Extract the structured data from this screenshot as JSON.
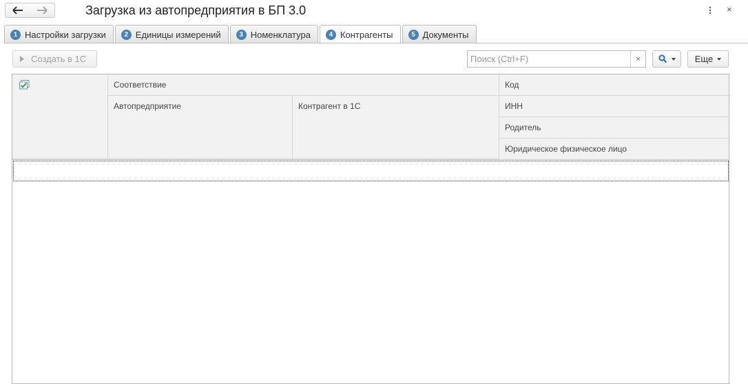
{
  "window": {
    "title": "Загрузка из автопредприятия в БП 3.0",
    "icons": {
      "back": "arrow-left-icon",
      "forward": "arrow-right-icon",
      "more": "vertical-dots-icon",
      "close": "close-icon"
    },
    "close_glyph": "×"
  },
  "tabs": [
    {
      "num": "1",
      "label": "Настройки загрузки",
      "active": false
    },
    {
      "num": "2",
      "label": "Единицы измерений",
      "active": false
    },
    {
      "num": "3",
      "label": "Номенклатура",
      "active": false
    },
    {
      "num": "4",
      "label": "Контрагенты",
      "active": true
    },
    {
      "num": "5",
      "label": "Документы",
      "active": false
    }
  ],
  "toolbar": {
    "create_label": "Создать в 1С",
    "create_enabled": false,
    "search_placeholder": "Поиск (Ctrl+F)",
    "search_value": "",
    "clear_glyph": "×",
    "more_label": "Еще"
  },
  "table": {
    "headers": {
      "match": "Соответствие",
      "autoenterprise": "Автопредприятие",
      "counterparty": "Контрагент в 1С",
      "code": "Код",
      "inn": "ИНН",
      "parent": "Родитель",
      "legal_type": "Юридическое физическое лицо"
    },
    "check_column_icon": "check-all-icon",
    "rows": []
  },
  "colors": {
    "tab_number_badge": "#4a82b4",
    "header_background": "#f2f2f2",
    "border": "#b7b7b7",
    "check_icon": "#3aa03a"
  }
}
